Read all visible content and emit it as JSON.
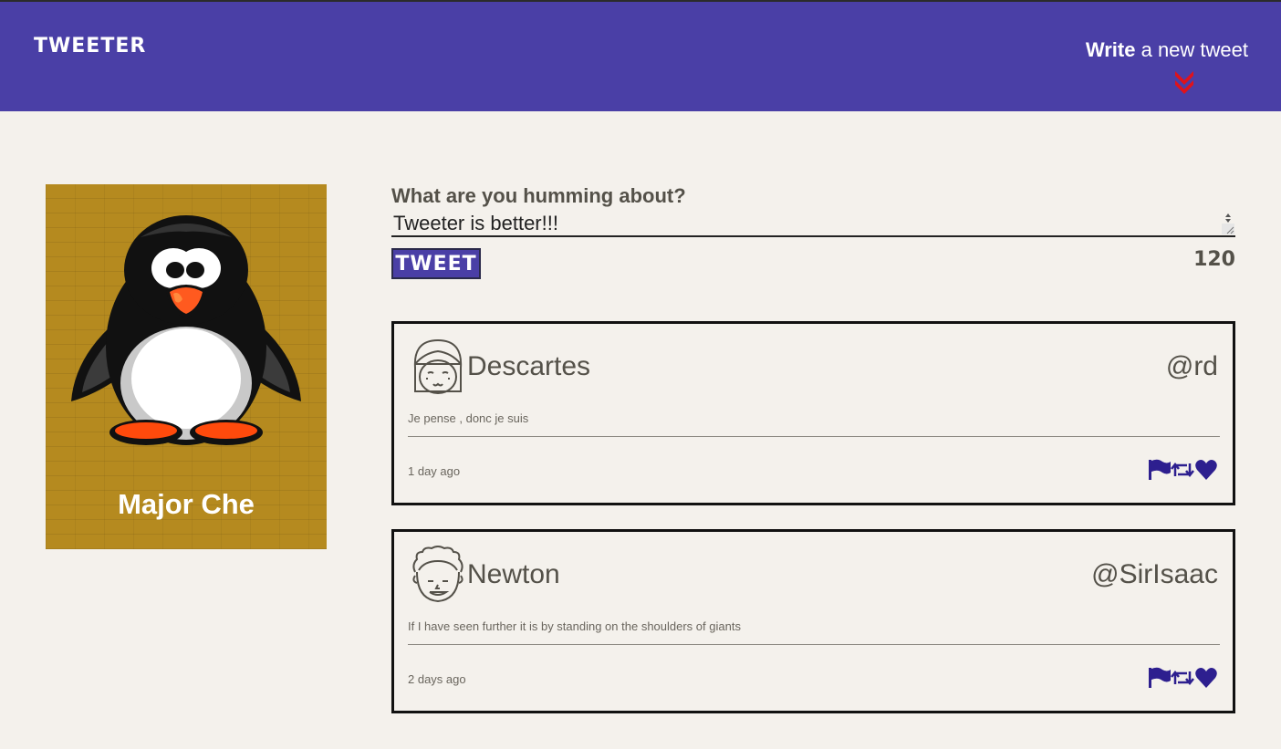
{
  "nav": {
    "brand": "TWEETER",
    "write_bold": "Write",
    "write_rest": " a new tweet"
  },
  "profile": {
    "name": "Major Che"
  },
  "compose": {
    "label": "What are you humming about?",
    "input_value": "Tweeter is better!!!",
    "button_label": "TWEET",
    "counter": "120"
  },
  "tweets": [
    {
      "name": "Descartes",
      "handle": "@rd",
      "text": "Je pense , donc je suis",
      "age": "1 day ago"
    },
    {
      "name": "Newton",
      "handle": "@SirIsaac",
      "text": "If I have seen further it is by standing on the shoulders of giants",
      "age": "2 days ago"
    }
  ],
  "colors": {
    "accent": "#4a3fa6",
    "chevron": "#e0121b",
    "action_icons": "#2d1f8f"
  }
}
